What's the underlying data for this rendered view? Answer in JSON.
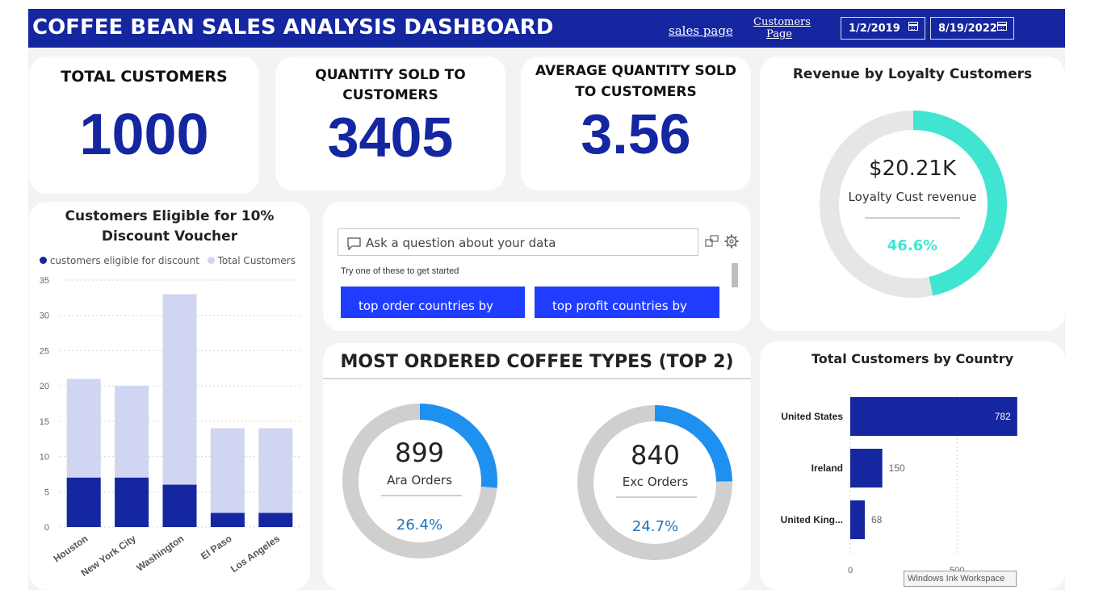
{
  "header": {
    "title": "COFFEE BEAN SALES ANALYSIS DASHBOARD",
    "nav": {
      "sales": "sales page",
      "customers_line1": "Customers",
      "customers_line2": "Page"
    },
    "date_start": "1/2/2019",
    "date_end": "8/19/2022"
  },
  "kpis": {
    "total_customers": {
      "label": "TOTAL CUSTOMERS",
      "value": "1000"
    },
    "quantity_sold": {
      "label_line1": "QUANTITY SOLD TO",
      "label_line2": "CUSTOMERS",
      "value": "3405"
    },
    "avg_quantity": {
      "label_line1": "AVERAGE QUANTITY SOLD",
      "label_line2": "TO CUSTOMERS",
      "value": "3.56"
    }
  },
  "loyalty": {
    "title": "Revenue by Loyalty Customers",
    "amount": "$20.21K",
    "caption": "Loyalty Cust revenue",
    "percent": "46.6%",
    "fraction": 0.466,
    "color": "#40e5d1"
  },
  "qa": {
    "placeholder": "Ask a question about your data",
    "hint": "Try one of these to get started",
    "suggestions": [
      "top order countries by",
      "top profit countries by"
    ]
  },
  "coffee_types": {
    "title": "MOST ORDERED COFFEE TYPES (TOP 2)",
    "items": [
      {
        "value": "899",
        "label": "Ara Orders",
        "percent": "26.4%",
        "fraction": 0.264
      },
      {
        "value": "840",
        "label": "Exc Orders",
        "percent": "24.7%",
        "fraction": 0.247
      }
    ],
    "color": "#1e90f0"
  },
  "chart_data": [
    {
      "type": "bar",
      "title": "Customers Eligible for 10% Discount Voucher",
      "categories": [
        "Houston",
        "New York City",
        "Washington",
        "El Paso",
        "Los Angeles"
      ],
      "series": [
        {
          "name": "customers eligible for discount",
          "values": [
            7,
            7,
            6,
            2,
            2
          ],
          "color": "#1426a0"
        },
        {
          "name": "Total Customers",
          "values": [
            21,
            20,
            33,
            14,
            14
          ],
          "color": "#d0d5f2"
        }
      ],
      "ylim": [
        0,
        35
      ],
      "yticks": [
        0,
        5,
        10,
        15,
        20,
        25,
        30,
        35
      ],
      "legend": "top-left",
      "grid": true
    },
    {
      "type": "bar",
      "orientation": "horizontal",
      "title": "Total Customers by Country",
      "categories": [
        "United States",
        "Ireland",
        "United King..."
      ],
      "values": [
        782,
        150,
        68
      ],
      "data_labels": [
        "782",
        "150",
        "68"
      ],
      "xticks": [
        0,
        500
      ],
      "xlim": [
        0,
        900
      ],
      "color": "#1426a0",
      "grid": true
    }
  ],
  "overlay": {
    "ink_workspace": "Windows Ink Workspace"
  }
}
